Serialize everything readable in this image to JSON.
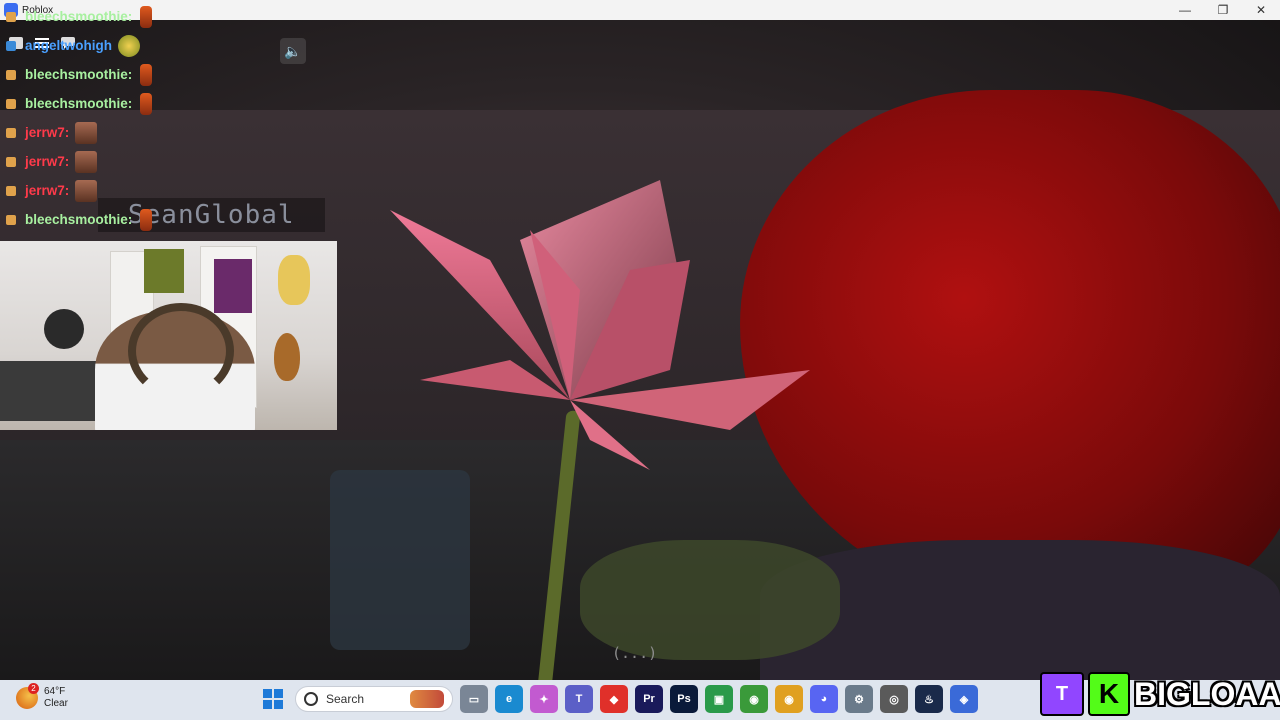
{
  "window": {
    "title": "Roblox",
    "controls": {
      "minimize": "—",
      "maximize": "❐",
      "close": "✕"
    }
  },
  "chat": {
    "messages": [
      {
        "user": "bleechsmoothie:",
        "color": "#a8f0a0",
        "emote": "smoothie"
      },
      {
        "user": "angeltwohigh",
        "color": "#4aa0ff",
        "emote": "gold"
      },
      {
        "user": "bleechsmoothie:",
        "color": "#a8f0a0",
        "emote": "smoothie"
      },
      {
        "user": "bleechsmoothie:",
        "color": "#a8f0a0",
        "emote": "smoothie"
      },
      {
        "user": "jerrw7:",
        "color": "#ff3a4a",
        "emote": "face"
      },
      {
        "user": "jerrw7:",
        "color": "#ff3a4a",
        "emote": "face"
      },
      {
        "user": "jerrw7:",
        "color": "#ff3a4a",
        "emote": "face"
      },
      {
        "user": "bleechsmoothie:",
        "color": "#a8f0a0",
        "emote": "smoothie"
      }
    ]
  },
  "game": {
    "nameplate": "SeanGlobal",
    "loading": "(...)"
  },
  "taskbar": {
    "weather": {
      "temp": "64°F",
      "condition": "Clear",
      "badge": "2"
    },
    "search_label": "Search",
    "apps": [
      {
        "name": "file-explorer-icon",
        "color": "#7a8696",
        "glyph": "▭"
      },
      {
        "name": "edge-icon",
        "color": "#1a8ad0",
        "glyph": "e"
      },
      {
        "name": "copilot-icon",
        "color": "#c25ad0",
        "glyph": "✦"
      },
      {
        "name": "teams-icon",
        "color": "#5b5fc7",
        "glyph": "T"
      },
      {
        "name": "redapp-icon",
        "color": "#e0302a",
        "glyph": "◆"
      },
      {
        "name": "premiere-icon",
        "color": "#1a1a5a",
        "glyph": "Pr"
      },
      {
        "name": "photoshop-icon",
        "color": "#0a1a3a",
        "glyph": "Ps"
      },
      {
        "name": "chat-app-icon",
        "color": "#2a9a4a",
        "glyph": "▣"
      },
      {
        "name": "chrome-badge-icon",
        "color": "#3a9a3a",
        "glyph": "◉"
      },
      {
        "name": "chrome-icon",
        "color": "#e0a020",
        "glyph": "◉"
      },
      {
        "name": "discord-icon",
        "color": "#5865f2",
        "glyph": "◕"
      },
      {
        "name": "settings-icon",
        "color": "#6a7a8a",
        "glyph": "⚙"
      },
      {
        "name": "recorder-icon",
        "color": "#5a5a5a",
        "glyph": "◎"
      },
      {
        "name": "steam-icon",
        "color": "#1a2a4a",
        "glyph": "♨"
      },
      {
        "name": "roblox-icon",
        "color": "#3a6ad8",
        "glyph": "◈"
      }
    ]
  },
  "brand": {
    "twitch": "T",
    "kick": "K",
    "name": "BIGLOAAF"
  }
}
